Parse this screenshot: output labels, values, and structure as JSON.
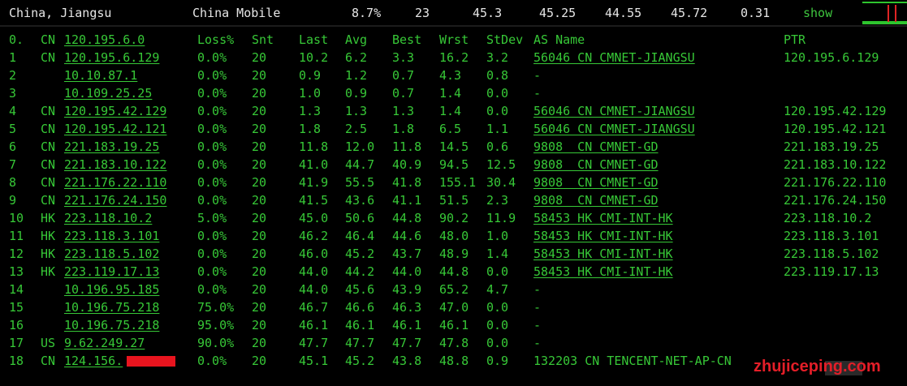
{
  "summary": {
    "location": "China, Jiangsu",
    "isp": "China Mobile",
    "loss": "8.7%",
    "sent": "23",
    "last": "45.3",
    "avg": "45.25",
    "best": "44.55",
    "worst": "45.72",
    "stdev": "0.31",
    "action": "show"
  },
  "headers": [
    "0.",
    "CN",
    "120.195.6.0",
    "Loss%",
    "Snt",
    "Last",
    "Avg",
    "Best",
    "Wrst",
    "StDev",
    "AS Name",
    "PTR"
  ],
  "hops": [
    {
      "hop": "1",
      "cc": "CN",
      "ip": "120.195.6.129",
      "loss": "0.0%",
      "snt": "20",
      "last": "10.2",
      "avg": "6.2",
      "best": "3.3",
      "wrst": "16.2",
      "stdev": "3.2",
      "asn": "56046 CN CMNET-JIANGSU",
      "ptr": "120.195.6.129"
    },
    {
      "hop": "2",
      "cc": "",
      "ip": "10.10.87.1",
      "loss": "0.0%",
      "snt": "20",
      "last": "0.9",
      "avg": "1.2",
      "best": "0.7",
      "wrst": "4.3",
      "stdev": "0.8",
      "asn": "-",
      "ptr": ""
    },
    {
      "hop": "3",
      "cc": "",
      "ip": "10.109.25.25",
      "loss": "0.0%",
      "snt": "20",
      "last": "1.0",
      "avg": "0.9",
      "best": "0.7",
      "wrst": "1.4",
      "stdev": "0.0",
      "asn": "-",
      "ptr": ""
    },
    {
      "hop": "4",
      "cc": "CN",
      "ip": "120.195.42.129",
      "loss": "0.0%",
      "snt": "20",
      "last": "1.3",
      "avg": "1.3",
      "best": "1.3",
      "wrst": "1.4",
      "stdev": "0.0",
      "asn": "56046 CN CMNET-JIANGSU",
      "ptr": "120.195.42.129"
    },
    {
      "hop": "5",
      "cc": "CN",
      "ip": "120.195.42.121",
      "loss": "0.0%",
      "snt": "20",
      "last": "1.8",
      "avg": "2.5",
      "best": "1.8",
      "wrst": "6.5",
      "stdev": "1.1",
      "asn": "56046 CN CMNET-JIANGSU",
      "ptr": "120.195.42.121"
    },
    {
      "hop": "6",
      "cc": "CN",
      "ip": "221.183.19.25",
      "loss": "0.0%",
      "snt": "20",
      "last": "11.8",
      "avg": "12.0",
      "best": "11.8",
      "wrst": "14.5",
      "stdev": "0.6",
      "asn": "9808  CN CMNET-GD",
      "ptr": "221.183.19.25"
    },
    {
      "hop": "7",
      "cc": "CN",
      "ip": "221.183.10.122",
      "loss": "0.0%",
      "snt": "20",
      "last": "41.0",
      "avg": "44.7",
      "best": "40.9",
      "wrst": "94.5",
      "stdev": "12.5",
      "asn": "9808  CN CMNET-GD",
      "ptr": "221.183.10.122"
    },
    {
      "hop": "8",
      "cc": "CN",
      "ip": "221.176.22.110",
      "loss": "0.0%",
      "snt": "20",
      "last": "41.9",
      "avg": "55.5",
      "best": "41.8",
      "wrst": "155.1",
      "stdev": "30.4",
      "asn": "9808  CN CMNET-GD",
      "ptr": "221.176.22.110"
    },
    {
      "hop": "9",
      "cc": "CN",
      "ip": "221.176.24.150",
      "loss": "0.0%",
      "snt": "20",
      "last": "41.5",
      "avg": "43.6",
      "best": "41.1",
      "wrst": "51.5",
      "stdev": "2.3",
      "asn": "9808  CN CMNET-GD",
      "ptr": "221.176.24.150"
    },
    {
      "hop": "10",
      "cc": "HK",
      "ip": "223.118.10.2",
      "loss": "5.0%",
      "snt": "20",
      "last": "45.0",
      "avg": "50.6",
      "best": "44.8",
      "wrst": "90.2",
      "stdev": "11.9",
      "asn": "58453 HK CMI-INT-HK",
      "ptr": "223.118.10.2"
    },
    {
      "hop": "11",
      "cc": "HK",
      "ip": "223.118.3.101",
      "loss": "0.0%",
      "snt": "20",
      "last": "46.2",
      "avg": "46.4",
      "best": "44.6",
      "wrst": "48.0",
      "stdev": "1.0",
      "asn": "58453 HK CMI-INT-HK",
      "ptr": "223.118.3.101"
    },
    {
      "hop": "12",
      "cc": "HK",
      "ip": "223.118.5.102",
      "loss": "0.0%",
      "snt": "20",
      "last": "46.0",
      "avg": "45.2",
      "best": "43.7",
      "wrst": "48.9",
      "stdev": "1.4",
      "asn": "58453 HK CMI-INT-HK",
      "ptr": "223.118.5.102"
    },
    {
      "hop": "13",
      "cc": "HK",
      "ip": "223.119.17.13",
      "loss": "0.0%",
      "snt": "20",
      "last": "44.0",
      "avg": "44.2",
      "best": "44.0",
      "wrst": "44.8",
      "stdev": "0.0",
      "asn": "58453 HK CMI-INT-HK",
      "ptr": "223.119.17.13"
    },
    {
      "hop": "14",
      "cc": "",
      "ip": "10.196.95.185",
      "loss": "0.0%",
      "snt": "20",
      "last": "44.0",
      "avg": "45.6",
      "best": "43.9",
      "wrst": "65.2",
      "stdev": "4.7",
      "asn": "-",
      "ptr": ""
    },
    {
      "hop": "15",
      "cc": "",
      "ip": "10.196.75.218",
      "loss": "75.0%",
      "snt": "20",
      "last": "46.7",
      "avg": "46.6",
      "best": "46.3",
      "wrst": "47.0",
      "stdev": "0.0",
      "asn": "-",
      "ptr": ""
    },
    {
      "hop": "16",
      "cc": "",
      "ip": "10.196.75.218",
      "loss": "95.0%",
      "snt": "20",
      "last": "46.1",
      "avg": "46.1",
      "best": "46.1",
      "wrst": "46.1",
      "stdev": "0.0",
      "asn": "-",
      "ptr": ""
    },
    {
      "hop": "17",
      "cc": "US",
      "ip": "9.62.249.27",
      "loss": "90.0%",
      "snt": "20",
      "last": "47.7",
      "avg": "47.7",
      "best": "47.7",
      "wrst": "47.8",
      "stdev": "0.0",
      "asn": "-",
      "ptr": ""
    },
    {
      "hop": "18",
      "cc": "CN",
      "ip": "124.156.",
      "loss": "0.0%",
      "snt": "20",
      "last": "45.1",
      "avg": "45.2",
      "best": "43.8",
      "wrst": "48.8",
      "stdev": "0.9",
      "asn": "132203 CN TENCENT-NET-AP-CN",
      "ptr": ""
    }
  ],
  "watermark": "zhujiceping.com",
  "colors": {
    "text": "#37c837",
    "background": "#000000",
    "redaction": "#e8141e",
    "watermark": "#e41e28"
  }
}
